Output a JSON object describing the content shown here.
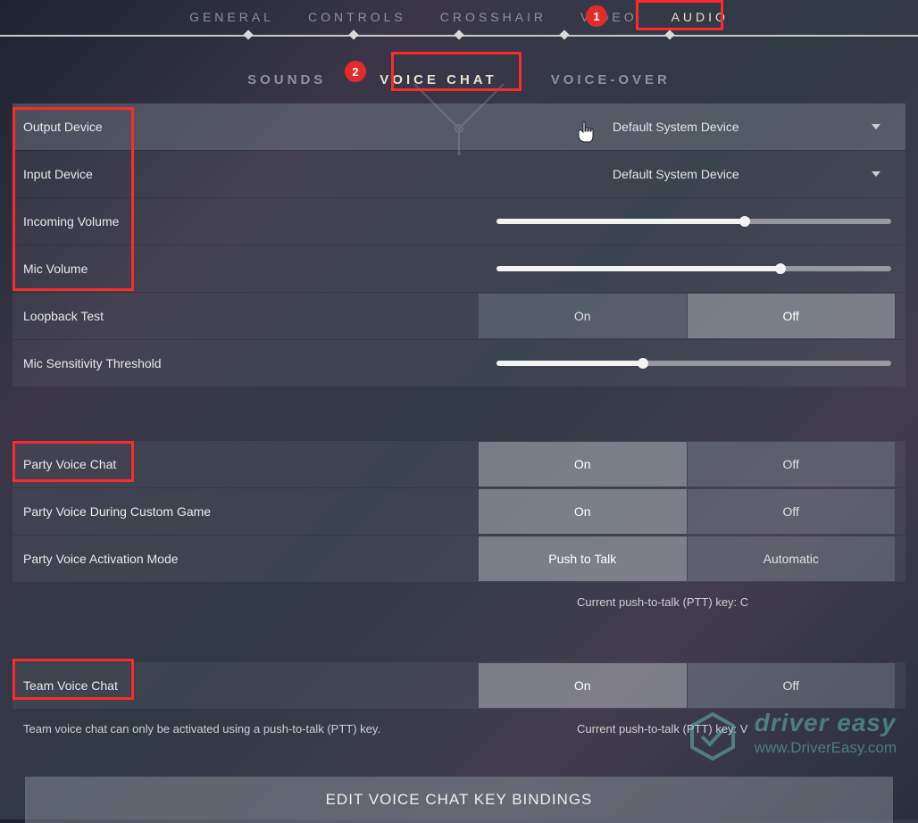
{
  "top_tabs": {
    "general": "GENERAL",
    "controls": "CONTROLS",
    "crosshair": "CROSSHAIR",
    "video": "VIDEO",
    "audio": "AUDIO"
  },
  "sub_tabs": {
    "sounds": "SOUNDS",
    "voice_chat": "VOICE CHAT",
    "voice_over": "VOICE-OVER"
  },
  "annotations": {
    "badge1": "1",
    "badge2": "2"
  },
  "settings": {
    "output_device": {
      "label": "Output Device",
      "value": "Default System Device"
    },
    "input_device": {
      "label": "Input Device",
      "value": "Default System Device"
    },
    "incoming_volume": {
      "label": "Incoming Volume",
      "percent": 63
    },
    "mic_volume": {
      "label": "Mic Volume",
      "percent": 72
    },
    "loopback": {
      "label": "Loopback Test",
      "on": "On",
      "off": "Off",
      "selected": "off"
    },
    "mic_sensitivity": {
      "label": "Mic Sensitivity Threshold",
      "percent": 37
    },
    "party_voice": {
      "label": "Party Voice Chat",
      "on": "On",
      "off": "Off",
      "selected": "on"
    },
    "party_custom": {
      "label": "Party Voice During Custom Game",
      "on": "On",
      "off": "Off",
      "selected": "on"
    },
    "party_activation": {
      "label": "Party Voice Activation Mode",
      "left": "Push to Talk",
      "right": "Automatic",
      "selected": "left"
    },
    "party_note": "Current push-to-talk (PTT) key: C",
    "team_voice": {
      "label": "Team Voice Chat",
      "on": "On",
      "off": "Off",
      "selected": "on"
    },
    "team_note_left": "Team voice chat can only be activated using a push-to-talk (PTT) key.",
    "team_note_right": "Current push-to-talk (PTT) key: V"
  },
  "big_button": "EDIT VOICE CHAT KEY BINDINGS",
  "watermark": {
    "title": "driver easy",
    "url": "www.DriverEasy.com"
  }
}
